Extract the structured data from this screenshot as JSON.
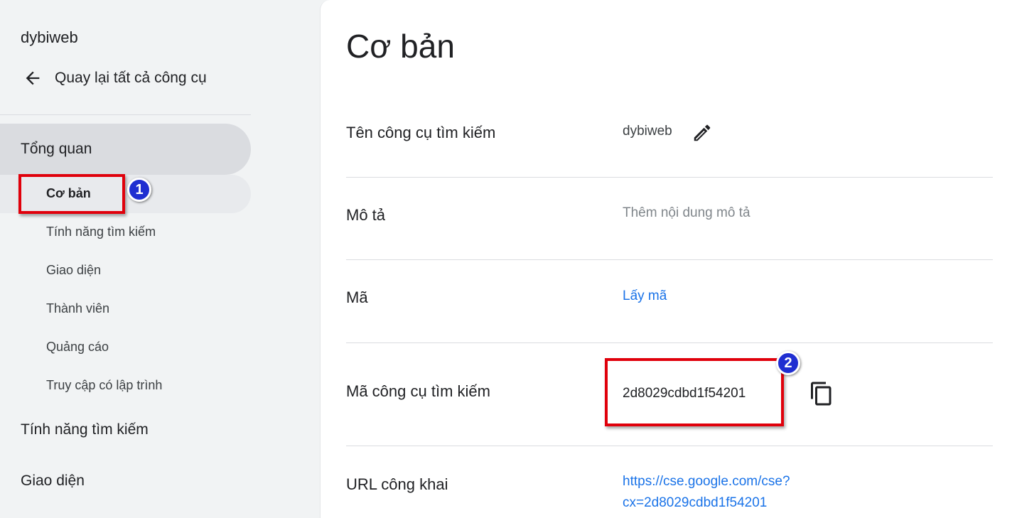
{
  "sidebar": {
    "engine_name": "dybiweb",
    "back_label": "Quay lại tất cả công cụ",
    "overview_label": "Tổng quan",
    "sub_items": [
      "Cơ bản",
      "Tính năng tìm kiếm",
      "Giao diện",
      "Thành viên",
      "Quảng cáo",
      "Truy cập có lập trình"
    ],
    "search_features_label": "Tính năng tìm kiếm",
    "appearance_label": "Giao diện"
  },
  "annotations": {
    "badge1": "1",
    "badge2": "2",
    "color": "#e0000b",
    "badge_color": "#1f2ed1"
  },
  "main": {
    "title": "Cơ bản",
    "rows": {
      "name": {
        "label": "Tên công cụ tìm kiếm",
        "value": "dybiweb"
      },
      "description": {
        "label": "Mô tả",
        "placeholder": "Thêm nội dung mô tả"
      },
      "code": {
        "label": "Mã",
        "link": "Lấy mã"
      },
      "search_engine_id": {
        "label": "Mã công cụ tìm kiếm",
        "value": "2d8029cdbd1f54201"
      },
      "public_url": {
        "label": "URL công khai",
        "line1": "https://cse.google.com/cse?",
        "line2": "cx=2d8029cdbd1f54201"
      }
    }
  },
  "colors": {
    "accent_link": "#1a73e8",
    "sidebar_bg": "#f1f3f4",
    "active_bg": "#dadce0"
  },
  "icons": {
    "back": "arrow-left-icon",
    "edit": "pencil-icon",
    "copy": "copy-icon"
  }
}
